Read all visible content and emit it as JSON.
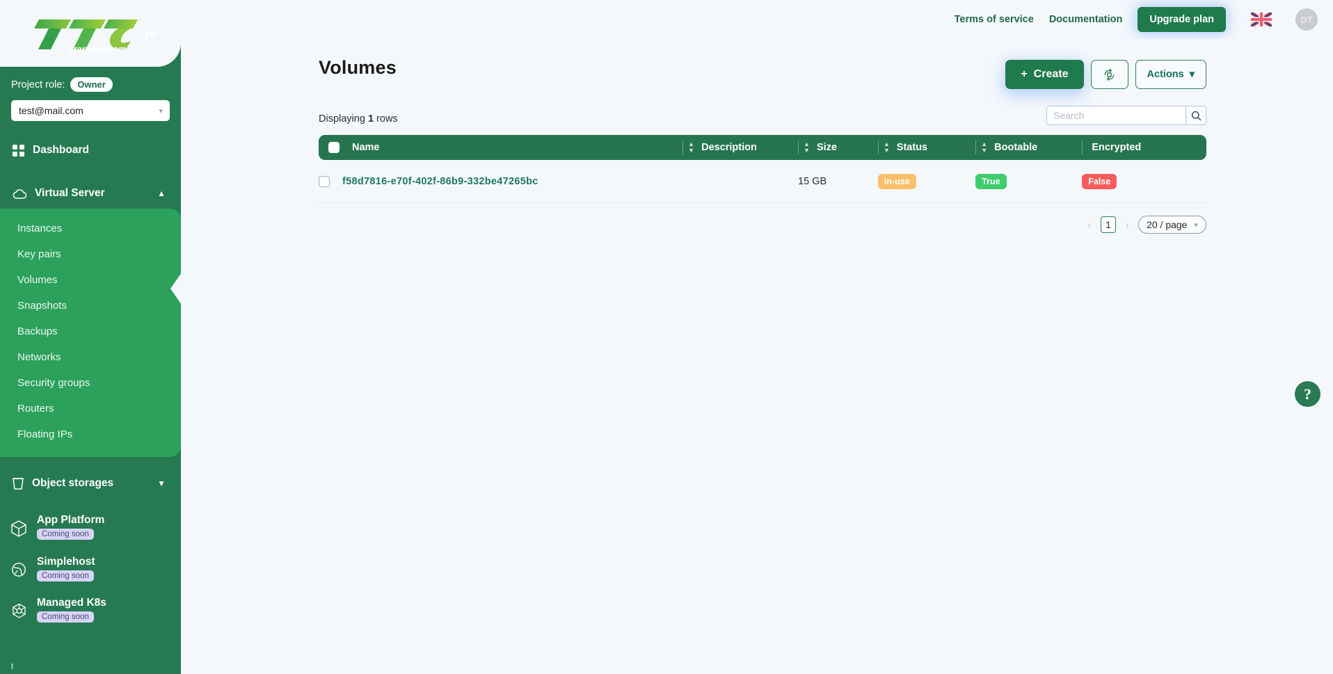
{
  "sidebar": {
    "logo_text": "TTC",
    "logo_sub": "Transtelecom",
    "collapse_icon": "collapse-left-icon",
    "role_label": "Project role:",
    "role_value": "Owner",
    "project_value": "test@mail.com",
    "nav": [
      {
        "label": "Dashboard",
        "icon": "grid-icon"
      },
      {
        "label": "Virtual Server",
        "icon": "cloud-icon",
        "chevron": "⌃"
      }
    ],
    "submenu": [
      {
        "label": "Instances"
      },
      {
        "label": "Key pairs"
      },
      {
        "label": "Volumes",
        "active": true
      },
      {
        "label": "Snapshots"
      },
      {
        "label": "Backups"
      },
      {
        "label": "Networks"
      },
      {
        "label": "Security groups"
      },
      {
        "label": "Routers"
      },
      {
        "label": "Floating IPs"
      }
    ],
    "object_storages": {
      "label": "Object storages",
      "icon": "bucket-icon"
    },
    "coming": [
      {
        "label": "App Platform",
        "badge": "Coming soon",
        "icon": "cube-icon"
      },
      {
        "label": "Simplehost",
        "badge": "Coming soon",
        "icon": "globe-icon"
      },
      {
        "label": "Managed K8s",
        "badge": "Coming soon",
        "icon": "kubernetes-icon"
      }
    ]
  },
  "topbar": {
    "terms_label": "Terms of service",
    "documentation_label": "Documentation",
    "upgrade_label": "Upgrade plan",
    "flag": "uk-flag-icon",
    "avatar_initials": "DT"
  },
  "page": {
    "title": "Volumes",
    "create_label": "Create",
    "create_plus": "+",
    "refresh_icon": "refresh-icon",
    "actions_label": "Actions",
    "actions_chevron": "⌄"
  },
  "table_bar": {
    "displaying_prefix": "Displaying",
    "displaying_count": "1",
    "displaying_suffix": "rows",
    "search_placeholder": "Search",
    "search_value": "",
    "search_icon": "search-icon"
  },
  "table": {
    "columns": [
      {
        "label": "Name",
        "sortable": true
      },
      {
        "label": "Description",
        "sortable": true
      },
      {
        "label": "Size",
        "sortable": true
      },
      {
        "label": "Status",
        "sortable": true
      },
      {
        "label": "Bootable",
        "sortable": true
      },
      {
        "label": "Encrypted",
        "sortable": true
      }
    ],
    "rows": [
      {
        "name": "f58d7816-e70f-402f-86b9-332be47265bc",
        "description": "",
        "size": "15 GB",
        "status": "in-use",
        "bootable": "True",
        "encrypted": "False"
      }
    ]
  },
  "pagination": {
    "prev": "‹",
    "page": "1",
    "next": "›",
    "per_page": "20 / page",
    "per_page_chevron": "⌄"
  },
  "help": {
    "label": "?"
  },
  "colors": {
    "brand_green": "#267a52",
    "submenu_green": "#2ba15b",
    "header_green": "#27754f",
    "status_in_use": "#fbbf68",
    "status_true": "#3ecc6c",
    "status_false": "#f75b5b",
    "link_green": "#1f7a5d",
    "page_bg": "#f4f8fb",
    "badge_soon_bg": "#d7d4f7"
  }
}
